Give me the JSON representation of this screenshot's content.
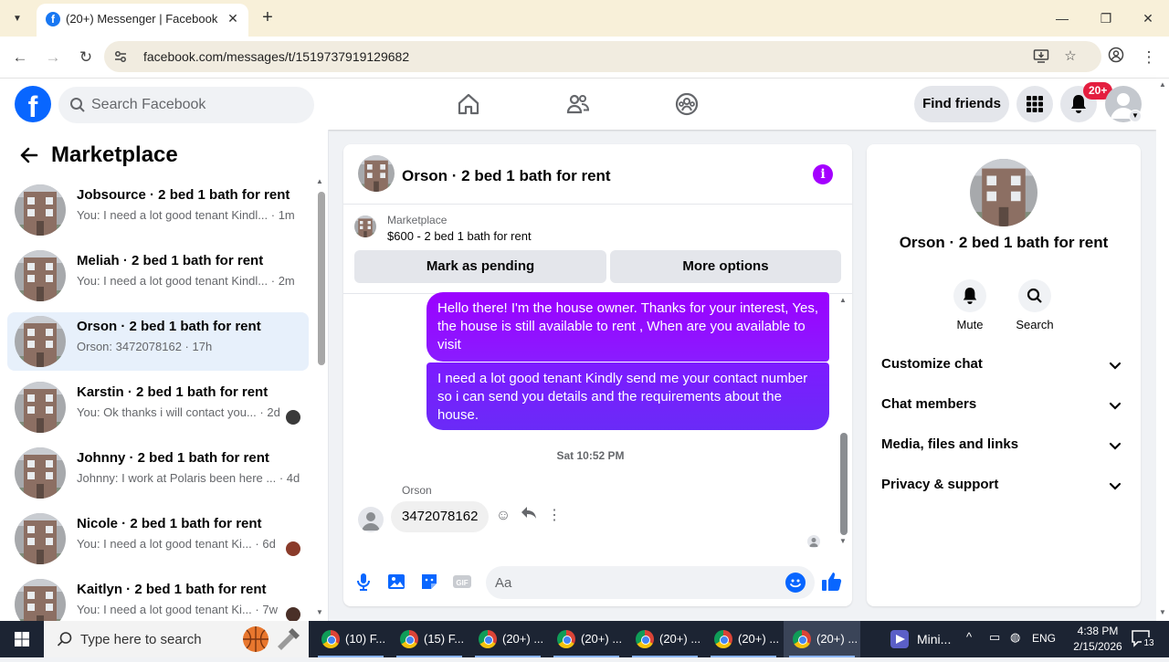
{
  "browser": {
    "tab_title": "(20+) Messenger | Facebook",
    "tab_favicon": "f",
    "url": "facebook.com/messages/t/1519737919129682",
    "site_info_icon": "tune-icon"
  },
  "fb": {
    "logo_letter": "f",
    "search_placeholder": "Search Facebook",
    "find_friends": "Find friends",
    "notif_badge": "20+"
  },
  "sidebar": {
    "title": "Marketplace",
    "conversations": [
      {
        "title": "Jobsource · 2 bed 1 bath for rent",
        "preview": "You: I need a lot good tenant Kindl...",
        "time": "1m"
      },
      {
        "title": "Meliah · 2 bed 1 bath for rent",
        "preview": "You: I need a lot good tenant Kindl...",
        "time": "2m"
      },
      {
        "title": "Orson · 2 bed 1 bath for rent",
        "preview": "Orson: 3472078162",
        "time": "17h"
      },
      {
        "title": "Karstin · 2 bed 1 bath for rent",
        "preview": "You: Ok thanks i will contact you...",
        "time": "2d"
      },
      {
        "title": "Johnny · 2 bed 1 bath for rent",
        "preview": "Johnny: I work at Polaris been here ...",
        "time": "4d"
      },
      {
        "title": "Nicole · 2 bed 1 bath for rent",
        "preview": "You: I need a lot good tenant Ki...",
        "time": "6d"
      },
      {
        "title": "Kaitlyn · 2 bed 1 bath for rent",
        "preview": "You: I need a lot good tenant Ki...",
        "time": "7w"
      }
    ]
  },
  "chat": {
    "title": "Orson · 2 bed 1 bath for rent",
    "listing_source": "Marketplace",
    "listing_price": "$600 - 2 bed 1 bath for rent",
    "mark_pending": "Mark as pending",
    "more_options": "More options",
    "messages": [
      "Hello there! I'm the house owner. Thanks for your interest, Yes, the house is still available to rent , When are you available to visit",
      "I need a lot good tenant Kindly send me your contact number so i can send you details and the requirements about the house."
    ],
    "timestamp": "Sat 10:52 PM",
    "sender": "Orson",
    "incoming": "3472078162",
    "composer_placeholder": "Aa"
  },
  "right_panel": {
    "title": "Orson · 2 bed 1 bath for rent",
    "mute": "Mute",
    "search": "Search",
    "rows": [
      "Customize chat",
      "Chat members",
      "Media, files and links",
      "Privacy & support"
    ]
  },
  "taskbar": {
    "search_placeholder": "Type here to search",
    "apps": [
      "(10) F...",
      "(15) F...",
      "(20+) ...",
      "(20+) ...",
      "(20+) ...",
      "(20+) ...",
      "(20+) ..."
    ],
    "mini_label": "Mini...",
    "lang": "ENG",
    "time": "4:38 PM",
    "date": "2/15/2026",
    "notif_count": "13"
  },
  "colors": {
    "fb_blue": "#0866ff",
    "message_purple": "#9b00ff",
    "message_indigo": "#6a2bf7",
    "active_conv_bg": "#e7f0fb",
    "notif_red": "#e41e3f"
  }
}
